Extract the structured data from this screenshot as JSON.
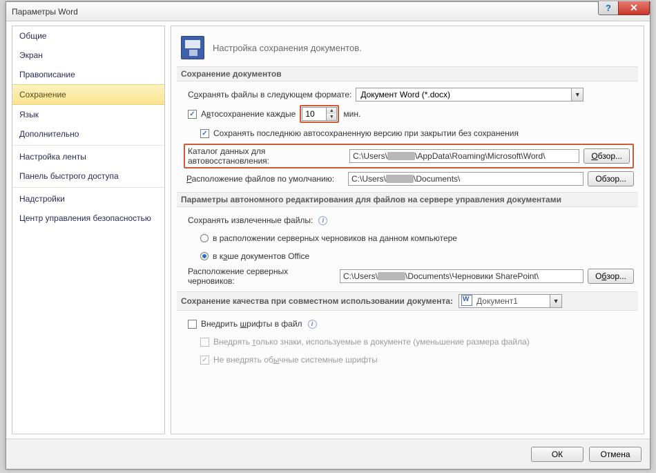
{
  "window": {
    "title": "Параметры Word"
  },
  "sidebar": {
    "items": [
      "Общие",
      "Экран",
      "Правописание",
      "Сохранение",
      "Язык",
      "Дополнительно",
      "Настройка ленты",
      "Панель быстрого доступа",
      "Надстройки",
      "Центр управления безопасностью"
    ],
    "active_index": 3
  },
  "header": {
    "text": "Настройка сохранения документов."
  },
  "sections": {
    "save_docs": "Сохранение документов",
    "offline": "Параметры автономного редактирования для файлов на сервере управления документами",
    "quality_prefix": "Сохранение качества при совместном использовании документа:"
  },
  "save": {
    "format_label_pre": "С",
    "format_label_ul": "о",
    "format_label_post": "хранять файлы в следующем формате:",
    "format_value": "Документ Word (*.docx)",
    "autosave_pre": "А",
    "autosave_ul": "в",
    "autosave_post": "тосохранение каждые",
    "autosave_minutes": "10",
    "autosave_unit": "мин.",
    "keep_last": "Сохранять последнюю автосохраненную версию при закрытии без сохранения",
    "autorecover_label_pre": "",
    "autorecover_label": "Каталог данных для автовосстановления:",
    "autorecover_p1": "C:\\Users\\",
    "autorecover_p2": "\\AppData\\Roaming\\Microsoft\\Word\\",
    "default_loc_label": "Расположение файлов по умолчанию:",
    "default_loc_p1": "C:\\Users\\",
    "default_loc_p2": "\\Documents\\",
    "browse": "Обзор..."
  },
  "offline": {
    "save_extracted": "Сохранять извлеченные файлы:",
    "opt_server": "в расположении серверных черновиков на данном компьютере",
    "opt_cache_pre": "в к",
    "opt_cache_ul": "э",
    "opt_cache_post": "ше документов Office",
    "drafts_label": "Расположение серверных черновиков:",
    "drafts_p1": "C:\\Users\\",
    "drafts_p2": "\\Documents\\Черновики SharePoint\\"
  },
  "quality": {
    "doc_name": "Документ1",
    "embed_fonts": "Внедрить шрифты в файл",
    "embed_only_used_pre": "Внедрять ",
    "embed_only_used_ul": "т",
    "embed_only_used_post": "олько знаки, используемые в документе (уменьшение размера файла)",
    "skip_system_pre": "Не внедрять об",
    "skip_system_ul": "ы",
    "skip_system_post": "чные системные шрифты"
  },
  "footer": {
    "ok": "ОК",
    "cancel": "Отмена"
  }
}
